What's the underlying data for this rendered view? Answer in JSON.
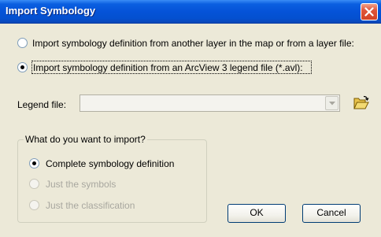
{
  "window": {
    "title": "Import Symbology"
  },
  "options": {
    "from_layer": "Import symbology definition from another layer in the map or from a layer file:",
    "from_avl": "Import symbology definition from an ArcView 3 legend file (*.avl):"
  },
  "legend": {
    "label": "Legend file:",
    "value": ""
  },
  "import_group": {
    "title": "What do you want to import?",
    "complete": "Complete symbology definition",
    "symbols": "Just the symbols",
    "classification": "Just the classification"
  },
  "buttons": {
    "ok": "OK",
    "cancel": "Cancel"
  },
  "icons": {
    "close": "close-icon",
    "folder": "open-folder-icon",
    "dropdown": "chevron-down-icon"
  },
  "colors": {
    "title_bar": "#0553d8",
    "close_button": "#e0553a",
    "dialog_bg": "#ece9d8"
  }
}
